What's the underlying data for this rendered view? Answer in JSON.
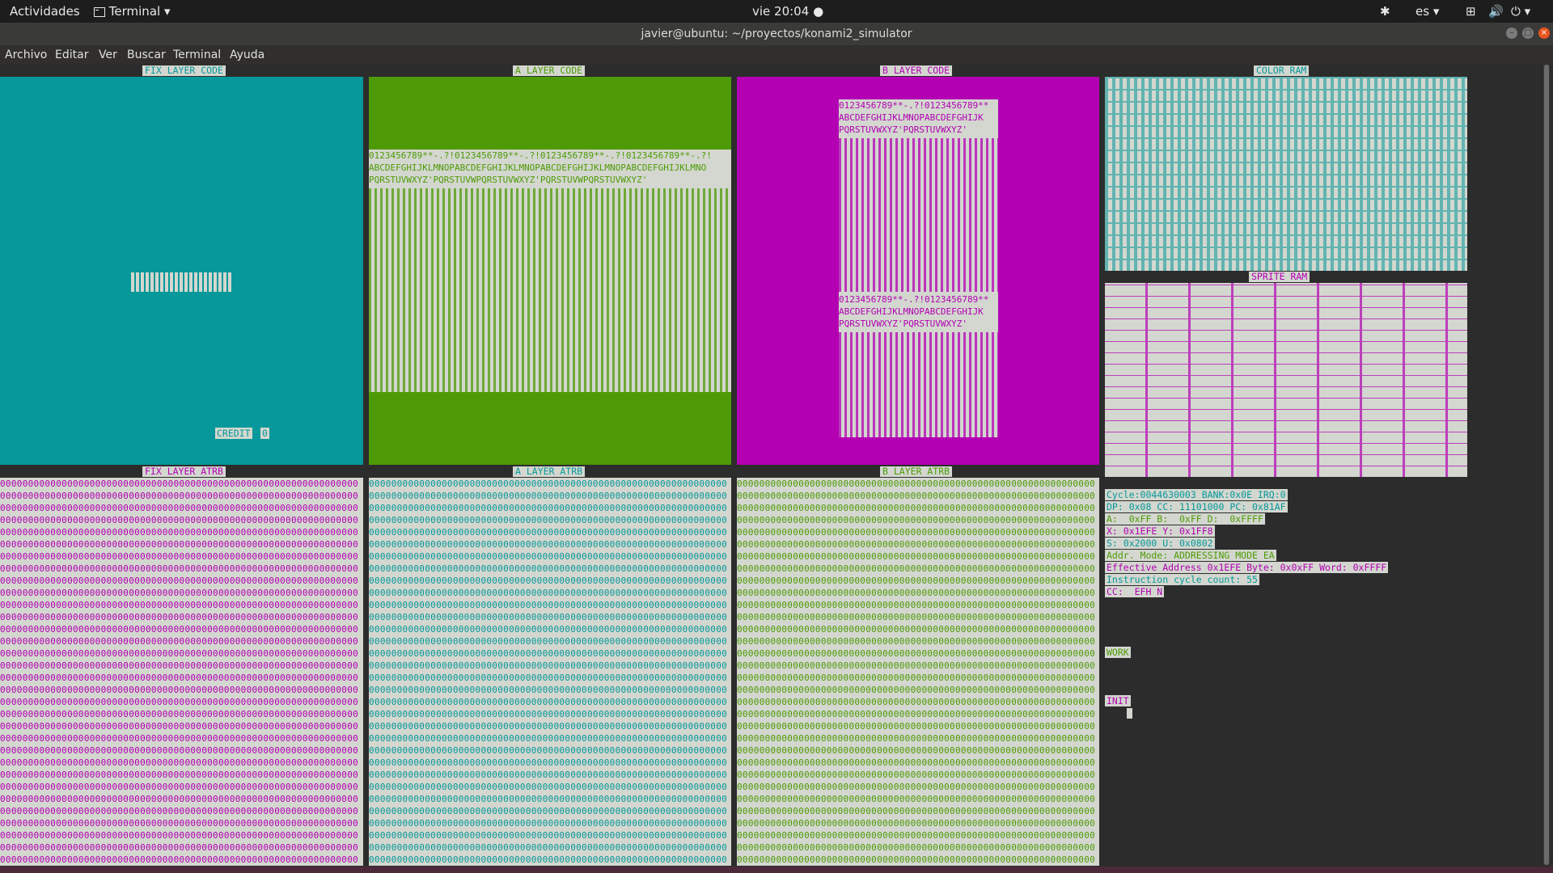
{
  "topbar": {
    "activities": "Actividades",
    "app_menu": "Terminal",
    "clock": "vie 20:04",
    "lang": "es"
  },
  "window": {
    "title": "javier@ubuntu: ~/proyectos/konami2_simulator"
  },
  "menu": [
    "Archivo",
    "Editar",
    "Ver",
    "Buscar",
    "Terminal",
    "Ayuda"
  ],
  "panels": {
    "fix_code": "FIX LAYER CODE",
    "a_code": "A LAYER CODE",
    "b_code": "B LAYER CODE",
    "color_ram": "COLOR RAM",
    "sprite_ram": "SPRITE RAM",
    "fix_atrb": "FIX LAYER ATRB",
    "a_atrb": "A LAYER ATRB",
    "b_atrb": "B LAYER ATRB"
  },
  "fix_layer": {
    "credit_label": "CREDIT",
    "credit_value": "0"
  },
  "charset": {
    "line1": "0123456789**-.?!0123456789**-.?!0123456789**-.?!0123456789**-.?!",
    "line2": "ABCDEFGHIJKLMNOPABCDEFGHIJKLMNOPABCDEFGHIJKLMNOPABCDEFGHIJKLMNO",
    "line3": "PQRSTUVWXYZ'PQRSTUVWPQRSTUVWXYZ'PQRSTUVWPQRSTUVWXYZ'",
    "b_line1": "0123456789**-.?!0123456789**",
    "b_line2": "ABCDEFGHIJKLMNOPABCDEFGHIJK",
    "b_line3": "PQRSTUVWXYZ'PQRSTUVWXYZ'"
  },
  "registers": {
    "cycle": "Cycle:0044630003 BANK:0x0E IRQ:0",
    "dp": "DP: 0x08 CC: 11101000 PC: 0x81AF",
    "ab": "A:  0xFF B:  0xFF D:  0xFFFF",
    "xy": "X: 0x1EFE Y: 0x1FF8",
    "su": "S: 0x2000 U: 0x0802",
    "mode": "Addr. Mode: ADDRESSING MODE EA",
    "ea": "Effective Address 0x1EFE Byte: 0x0xFF Word: 0xFFFF",
    "icount": "Instruction cycle count: 55",
    "cc": "CC:  EFH N",
    "work": "WORK",
    "init": "INIT"
  },
  "colors": {
    "fix": "#06989a",
    "a": "#4e9a06",
    "b": "#b300b3",
    "panel_bg": "#d3d7cf"
  }
}
